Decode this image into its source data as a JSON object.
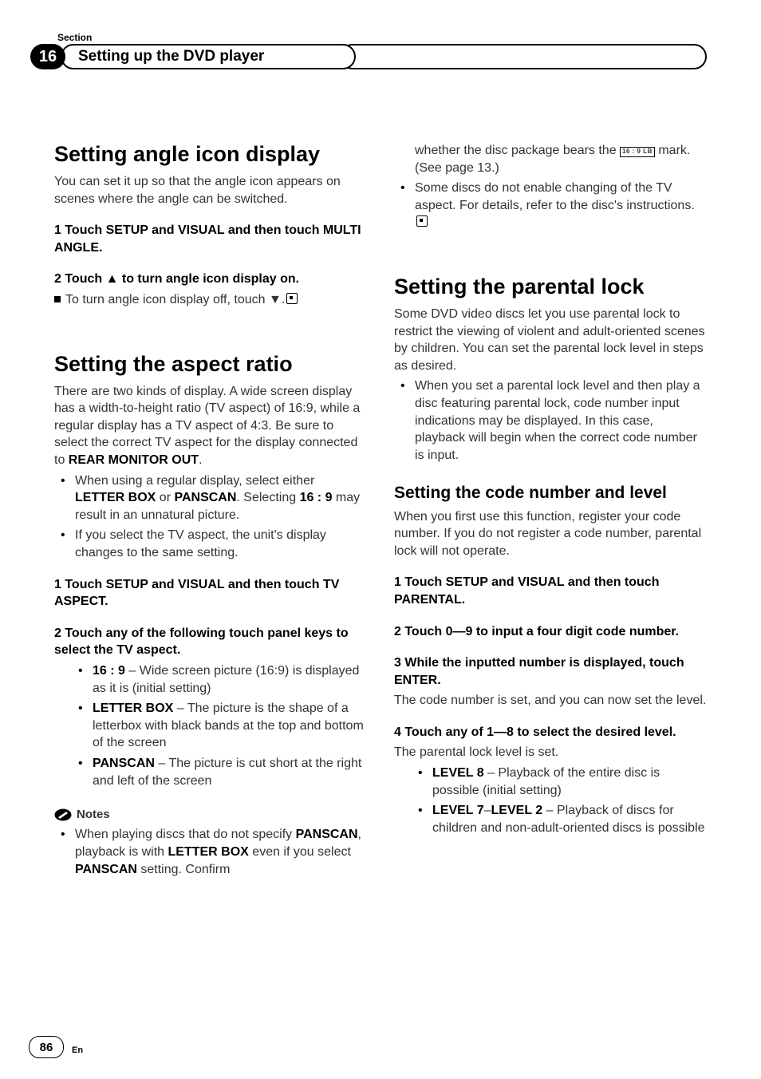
{
  "header": {
    "section_label": "Section",
    "chapter_number": "16",
    "chapter_title": "Setting up the DVD player"
  },
  "left": {
    "h1a": "Setting angle icon display",
    "p1": "You can set it up so that the angle icon appears on scenes where the angle can be switched.",
    "step1": "1    Touch SETUP and VISUAL and then touch MULTI ANGLE.",
    "step2": "2    Touch ▲ to turn angle icon display on.",
    "sq1": "To turn angle icon display off, touch ▼.",
    "h1b": "Setting the aspect ratio",
    "p2a": "There are two kinds of display. A wide screen display has a width-to-height ratio (TV aspect) of 16:9, while a regular display has a TV aspect of 4:3. Be sure to select the correct TV aspect for the display connected to ",
    "p2b": "REAR MONITOR OUT",
    "bul1a_a": "When using a regular display, select either ",
    "bul1a_b": "LETTER BOX",
    "bul1a_c": " or ",
    "bul1a_d": "PANSCAN",
    "bul1a_e": ". Selecting ",
    "bul1a_f": "16 : 9",
    "bul1a_g": " may result in an unnatural picture.",
    "bul1b": "If you select the TV aspect, the unit's display changes to the same setting.",
    "step3": "1    Touch SETUP and VISUAL and then touch TV ASPECT.",
    "step4": "2    Touch any of the following touch panel keys to select the TV aspect.",
    "opt1_k": "16 : 9",
    "opt1_v": " – Wide screen picture (16:9) is displayed as it is (initial setting)",
    "opt2_k": "LETTER BOX",
    "opt2_v": " – The picture is the shape of a letterbox with black bands at the top and bottom of the screen",
    "opt3_k": "PANSCAN",
    "opt3_v": " – The picture is cut short at the right and left of the screen",
    "notes_label": "Notes",
    "note1_a": "When playing discs that do not specify ",
    "note1_b": "PANSCAN",
    "note1_c": ", playback is with ",
    "note1_d": "LETTER BOX",
    "note1_e": " even if you select ",
    "note1_f": "PANSCAN",
    "note1_g": " setting. Confirm"
  },
  "right": {
    "cont1": "whether the disc package bears the ",
    "cont2": " mark. (See page 13.)",
    "cont_bul": "Some discs do not enable changing of the TV aspect. For details, refer to the disc's instructions.",
    "h1c": "Setting the parental lock",
    "p3": "Some DVD video discs let you use parental lock to restrict the viewing of violent and adult-oriented scenes by children. You can set the parental lock level in steps as desired.",
    "bul2": "When you set a parental lock level and then play a disc featuring parental lock, code number input indications may be displayed. In this case, playback will begin when the correct code number is input.",
    "h2": "Setting the code number and level",
    "p4": "When you first use this function, register your code number. If you do not register a code number, parental lock will not operate.",
    "step5": "1    Touch SETUP and VISUAL and then touch PARENTAL.",
    "step6": "2    Touch 0—9 to input a four digit code number.",
    "step7": "3    While the inputted number is displayed, touch ENTER.",
    "p5": "The code number is set, and you can now set the level.",
    "step8": "4    Touch any of 1—8 to select the desired level.",
    "p6": "The parental lock level is set.",
    "lvl1_k": "LEVEL 8",
    "lvl1_v": " – Playback of the entire disc is possible (initial setting)",
    "lvl2_k": "LEVEL 7",
    "lvl2_sep": "–",
    "lvl2_k2": "LEVEL 2",
    "lvl2_v": " – Playback of discs for children and non-adult-oriented discs is possible"
  },
  "lbicon_text": "16 : 9  LB",
  "footer": {
    "page": "86",
    "lang": "En"
  }
}
